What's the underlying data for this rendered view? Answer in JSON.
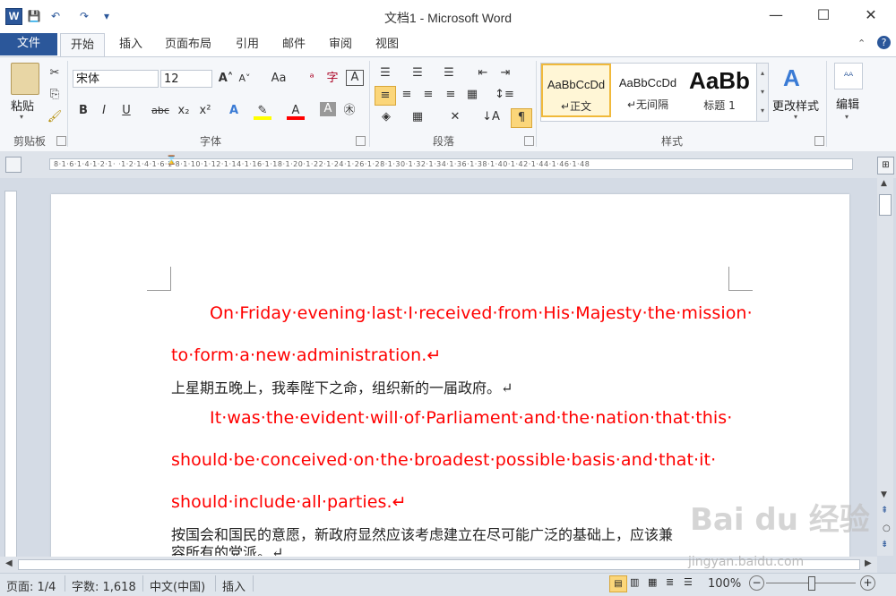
{
  "window": {
    "title": "文档1 - Microsoft Word",
    "logo": "W",
    "qat": {
      "save": "💾",
      "undo": "↶",
      "redo": "↷",
      "customize": "▾"
    },
    "controls": {
      "minimize": "—",
      "maximize": "☐",
      "close": "✕"
    }
  },
  "ribbon": {
    "file_tab": "文件",
    "tabs": [
      "开始",
      "插入",
      "页面布局",
      "引用",
      "邮件",
      "审阅",
      "视图"
    ],
    "active_tab": "开始",
    "clipboard": {
      "paste": "粘贴",
      "label": "剪贴板"
    },
    "font": {
      "name": "宋体",
      "size": "12",
      "grow": "A˄",
      "shrink": "A˅",
      "case": "Aa",
      "bold": "B",
      "italic": "I",
      "underline": "U",
      "strike": "abc",
      "subscript": "x₂",
      "superscript": "x²",
      "label": "字体"
    },
    "paragraph": {
      "label": "段落"
    },
    "styles": {
      "items": [
        {
          "sample": "AaBbCcDd",
          "name": "↵正文"
        },
        {
          "sample": "AaBbCcDd",
          "name": "↵无间隔"
        },
        {
          "sample": "AaBb",
          "name": "标题 1"
        }
      ],
      "change_styles": "更改样式",
      "label": "样式"
    },
    "editing": {
      "label": "编辑"
    }
  },
  "document": {
    "lines": [
      {
        "lang": "en",
        "text": "On·Friday·evening·last·I·received·from·His·Majesty·the·mission·"
      },
      {
        "lang": "en",
        "text": "to·form·a·new·administration.↵"
      },
      {
        "lang": "zh",
        "text": "上星期五晚上，我奉陛下之命，组织新的一届政府。↵"
      },
      {
        "lang": "en",
        "text": "It·was·the·evident·will·of·Parliament·and·the·nation·that·this·"
      },
      {
        "lang": "en",
        "text": "should·be·conceived·on·the·broadest·possible·basis·and·that·it·"
      },
      {
        "lang": "en",
        "text": "should·include·all·parties.↵"
      },
      {
        "lang": "zh",
        "text": "按国会和国民的意愿，新政府显然应该考虑建立在尽可能广泛的基础上，应该兼"
      },
      {
        "lang": "zh",
        "text": "容所有的党派。↵"
      }
    ]
  },
  "ruler": {
    "ticks": "8·1·6·1·4·1·2·1·  ·1·2·1·4·1·6·1·8·1·10·1·12·1·14·1·16·1·18·1·20·1·22·1·24·1·26·1·28·1·30·1·32·1·34·1·36·1·38·1·40·1·42·1·44·1·46·1·48"
  },
  "status": {
    "page": "页面: 1/4",
    "words": "字数: 1,618",
    "language": "中文(中国)",
    "mode": "插入",
    "zoom": "100%"
  },
  "watermark": {
    "text": "Bai du 经验",
    "url": "jingyan.baidu.com"
  },
  "colors": {
    "accent": "#2b579a",
    "english_text": "#ff0000",
    "chinese_text": "#222222"
  }
}
